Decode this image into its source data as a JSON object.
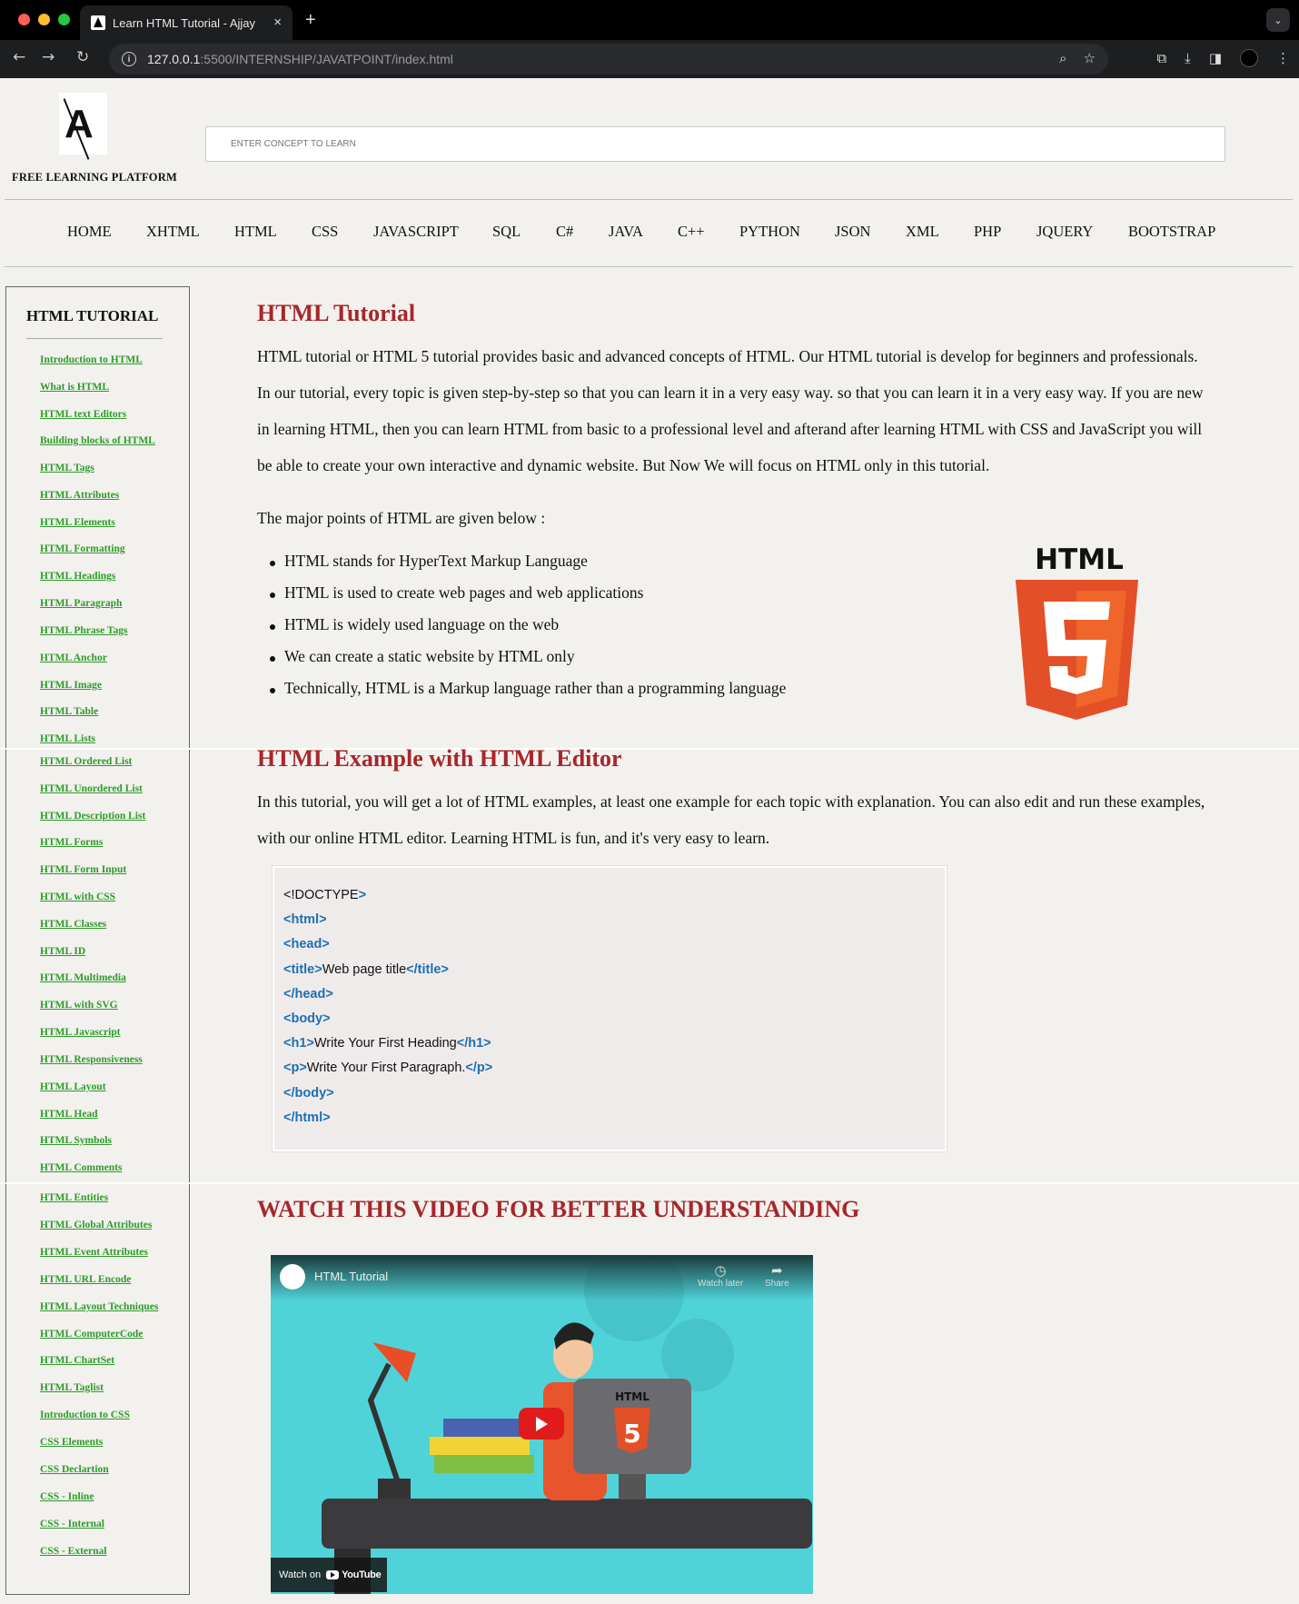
{
  "browser": {
    "tab_title": "Learn HTML Tutorial - Ajjay",
    "tab_close": "×",
    "new_tab": "+",
    "tab_list": "⌄",
    "url_host": "127.0.0.1",
    "url_rest": ":5500/INTERNSHIP/JAVATPOINT/index.html",
    "traffic_colors": [
      "#ff5f57",
      "#febc2e",
      "#28c840"
    ]
  },
  "header": {
    "logo_letter": "A",
    "brand": "FREE LEARNING PLATFORM",
    "search_placeholder": "ENTER CONCEPT TO LEARN"
  },
  "nav": [
    "HOME",
    "XHTML",
    "HTML",
    "CSS",
    "JAVASCRIPT",
    "SQL",
    "C#",
    "JAVA",
    "C++",
    "PYTHON",
    "JSON",
    "XML",
    "PHP",
    "JQUERY",
    "BOOTSTRAP"
  ],
  "sidebar": {
    "title": "HTML TUTORIAL",
    "links": [
      "Introduction to HTML",
      "What is HTML",
      "HTML text Editors",
      "Building blocks of HTML",
      "HTML Tags",
      "HTML Attributes",
      "HTML Elements",
      "HTML Formatting",
      "HTML Headings",
      "HTML Paragraph",
      "HTML Phrase Tags",
      "HTML Anchor",
      "HTML Image",
      "HTML Table",
      "HTML Lists",
      "HTML Ordered List",
      "HTML Unordered List",
      "HTML Description List",
      "HTML Forms",
      "HTML Form Input",
      "HTML with CSS",
      "HTML Classes",
      "HTML ID",
      "HTML Multimedia",
      "HTML with SVG",
      "HTML Javascript",
      "HTML Responsiveness",
      "HTML Layout",
      "HTML Head",
      "HTML Symbols",
      "HTML Comments",
      "HTML Entities",
      "HTML Global Attributes",
      "HTML Event Attributes",
      "HTML URL Encode",
      "HTML Layout Techniques",
      "HTML ComputerCode",
      "HTML ChartSet",
      "HTML Taglist",
      "Introduction to CSS",
      "CSS Elements",
      "CSS Declartion",
      "CSS - Inline",
      "CSS - Internal",
      "CSS - External"
    ]
  },
  "content": {
    "h1": "HTML Tutorial",
    "intro_lines": [
      "HTML tutorial or HTML 5 tutorial provides basic and advanced concepts of HTML. Our HTML tutorial is develop for beginners and professionals.",
      "In our tutorial, every topic is given step-by-step so that you can learn it in a very easy way. so that you can learn it in a very easy way. If you are new",
      "in learning HTML, then you can learn HTML from basic to a professional level and afterand after learning HTML with CSS and JavaScript you will",
      "be able to create your own interactive and dynamic website. But Now We will focus on HTML only in this tutorial."
    ],
    "major_points_title": "The major points of HTML are given below :",
    "bullets": [
      "HTML stands for HyperText Markup Language",
      "HTML is used to create web pages and web applications",
      "HTML is widely used language on the web",
      "We can create a static website by HTML only",
      "Technically, HTML is a Markup language rather than a programming language"
    ],
    "html5_logo_text": "HTML",
    "html5_logo_number": "5",
    "h2": "HTML Example with HTML Editor",
    "example_lines": [
      "In this tutorial, you will get a lot of HTML examples, at least one example for each topic with explanation. You can also edit and run these examples,",
      "with our online HTML editor. Learning HTML is fun, and it's very easy to learn."
    ],
    "code": [
      {
        "pre": "<!DOCTYPE",
        "tag1": ">",
        "text": "",
        "tag2": ""
      },
      {
        "pre": "",
        "tag1": "<html>",
        "text": "",
        "tag2": ""
      },
      {
        "pre": "",
        "tag1": "<head>",
        "text": "",
        "tag2": ""
      },
      {
        "pre": "",
        "tag1": "<title>",
        "text": "Web page title",
        "tag2": "</title>"
      },
      {
        "pre": "",
        "tag1": "</head>",
        "text": "",
        "tag2": ""
      },
      {
        "pre": "",
        "tag1": "<body>",
        "text": "",
        "tag2": ""
      },
      {
        "pre": "",
        "tag1": "<h1>",
        "text": "Write Your First Heading",
        "tag2": "</h1>"
      },
      {
        "pre": "",
        "tag1": "<p>",
        "text": "Write Your First Paragraph.",
        "tag2": "</p>"
      },
      {
        "pre": "",
        "tag1": "</body>",
        "text": "",
        "tag2": ""
      },
      {
        "pre": "",
        "tag1": "</html>",
        "text": "",
        "tag2": ""
      }
    ],
    "h3": "WATCH THIS VIDEO FOR BETTER UNDERSTANDING",
    "video": {
      "title": "HTML Tutorial",
      "watch_later": "Watch later",
      "share": "Share",
      "watch_on": "Watch on",
      "youtube": "YouTube",
      "monitor_text": "HTML",
      "monitor_number": "5"
    }
  },
  "colors": {
    "heading": "#a8262a",
    "sidebar_link": "#2e9b2a",
    "code_tag": "#1d6fb3"
  }
}
